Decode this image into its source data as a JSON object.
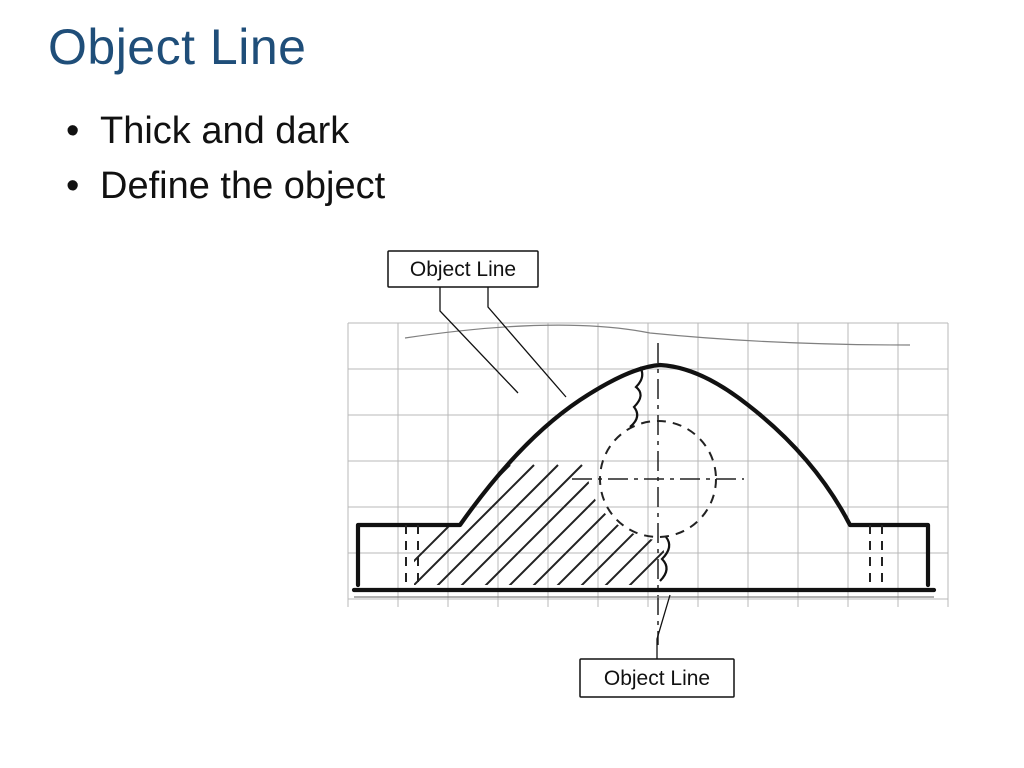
{
  "title": "Object Line",
  "bullets": [
    "Thick and dark",
    "Define the object"
  ],
  "figure": {
    "callout_top": "Object Line",
    "callout_bottom": "Object Line"
  }
}
